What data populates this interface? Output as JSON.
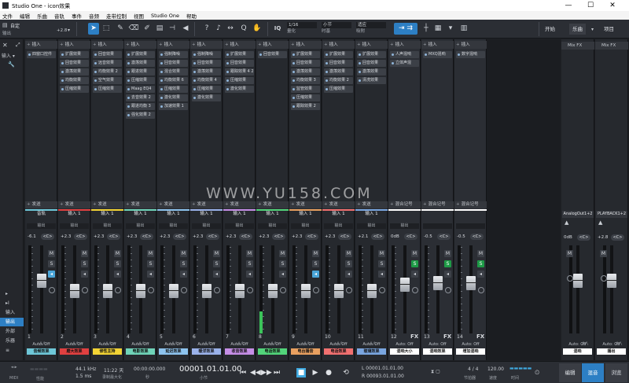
{
  "window": {
    "title": "Studio One - icon效果",
    "minimize": "—",
    "maximize": "☐",
    "close": "✕"
  },
  "menu": [
    "文件",
    "编辑",
    "乐曲",
    "音轨",
    "事件",
    "音频",
    "走带控制",
    "视图",
    "Studio One",
    "帮助"
  ],
  "toolbar": {
    "preset_name": "自定",
    "preset_sub": "输出",
    "gain_readout": "+2.8",
    "quantize": {
      "label": "1/16",
      "sub": "量化"
    },
    "timebase": {
      "label": "小节",
      "sub": "时基"
    },
    "snap": {
      "label": "适应",
      "sub": "吸附"
    },
    "iq": "IQ",
    "right_tabs": [
      "开始",
      "乐曲",
      "项目"
    ],
    "accent": "#2d7fc4"
  },
  "left_strip": {
    "close": "✕",
    "input_label": "输入 ▾",
    "tool": "🔧",
    "nav": [
      "▸",
      "▸I",
      "输入",
      "输出",
      "外部",
      "乐器",
      "≡"
    ]
  },
  "channels": [
    {
      "name": "音轨",
      "io_a": "",
      "io_b": "输出",
      "gain": "-6.1",
      "pan": "<C>",
      "number": "1",
      "auto": "Auto: Off",
      "label": "音频效果",
      "color": "#6ec7d8",
      "fader": 0.6,
      "meter": 0,
      "inserts": [
        "四窗口控件"
      ],
      "solo": false,
      "mon": true
    },
    {
      "name": "输入 1",
      "io_a": "",
      "io_b": "输出",
      "gain": "+2.3",
      "pan": "<C>",
      "number": "2",
      "auto": "Auto: Off",
      "label": "磨大效果",
      "color": "#e04040",
      "fader": 0.48,
      "meter": 0,
      "inserts": [
        "扩展效果",
        "回音效果",
        "激荡效果",
        "均衡效果",
        "压缩效果"
      ],
      "solo": false,
      "mon": false
    },
    {
      "name": "输入 1",
      "io_a": "",
      "io_b": "输出",
      "gain": "+2.3",
      "pan": "<C>",
      "number": "3",
      "auto": "Auto: Off",
      "label": "修性主持",
      "color": "#f2d335",
      "fader": 0.48,
      "meter": 0,
      "inserts": [
        "回音效果",
        "远音效果",
        "均衡效果 2",
        "空气效果",
        "压缩效果"
      ],
      "solo": false,
      "mon": false
    },
    {
      "name": "输入 1",
      "io_a": "",
      "io_b": "输出",
      "gain": "+2.3",
      "pan": "<C>",
      "number": "4",
      "auto": "Auto: Off",
      "label": "电影效果",
      "color": "#6fd3b8",
      "fader": 0.48,
      "meter": 0,
      "inserts": [
        "扩展效果",
        "激荡效果",
        "跟进效果",
        "压缩效果",
        "Maag EQ4",
        "去音效果 2",
        "跟进均衡 3",
        "强化效果 2"
      ],
      "solo": false,
      "mon": false
    },
    {
      "name": "输入 1",
      "io_a": "",
      "io_b": "输出",
      "gain": "+2.3",
      "pan": "<C>",
      "number": "5",
      "auto": "Auto: Off",
      "label": "延迟效果",
      "color": "#8dc3ee",
      "fader": 0.48,
      "meter": 0,
      "inserts": [
        "强制降噪",
        "回音效果",
        "混合效果",
        "均衡效果 6",
        "压缩效果",
        "激化效果",
        "加速效果 1"
      ],
      "solo": false,
      "mon": false
    },
    {
      "name": "输入 1",
      "io_a": "",
      "io_b": "输出",
      "gain": "+2.3",
      "pan": "<C>",
      "number": "6",
      "auto": "Auto: Off",
      "label": "暖洋效果",
      "color": "#9ab2ea",
      "fader": 0.48,
      "meter": 0,
      "inserts": [
        "强制降噪",
        "回音效果",
        "激荡效果",
        "均衡效果 4",
        "压缩效果",
        "激化效果"
      ],
      "solo": false,
      "mon": false
    },
    {
      "name": "输入 1",
      "io_a": "",
      "io_b": "输出",
      "gain": "+2.3",
      "pan": "<C>",
      "number": "7",
      "auto": "Auto: Off",
      "label": "收音效果",
      "color": "#c58ee6",
      "fader": 0.48,
      "meter": 0,
      "inserts": [
        "扩展效果",
        "回音效果",
        "跟踪效果 4 2",
        "压缩效果",
        "激化效果"
      ],
      "solo": false,
      "mon": false
    },
    {
      "name": "输入 1",
      "io_a": "",
      "io_b": "输出",
      "gain": "+2.3",
      "pan": "<C>",
      "number": "8",
      "auto": "Auto: Off",
      "label": "电话效果",
      "color": "#52d47a",
      "fader": 0.48,
      "meter": 0.25,
      "inserts": [
        "回音效果"
      ],
      "solo": false,
      "mon": false
    },
    {
      "name": "输入 1",
      "io_a": "",
      "io_b": "输出",
      "gain": "+2.3",
      "pan": "<C>",
      "number": "9",
      "auto": "Auto: Off",
      "label": "电台播音",
      "color": "#e8a060",
      "fader": 0.48,
      "meter": 0,
      "inserts": [
        "扩展效果",
        "回音效果",
        "激荡效果",
        "均衡效果 3",
        "监管效果",
        "压缩效果",
        "跟踪效果 2"
      ],
      "solo": false,
      "mon": true
    },
    {
      "name": "输入 1",
      "io_a": "",
      "io_b": "输出",
      "gain": "+2.3",
      "pan": "<C>",
      "number": "10",
      "auto": "Auto: Off",
      "label": "电话效果",
      "color": "#f07070",
      "fader": 0.48,
      "meter": 0,
      "inserts": [
        "扩展效果",
        "回音效果",
        "激荡效果",
        "均衡效果 2",
        "压缩效果"
      ],
      "solo": false,
      "mon": false
    },
    {
      "name": "输入 1",
      "io_a": "",
      "io_b": "输出",
      "gain": "+2.1",
      "pan": "<C>",
      "number": "11",
      "auto": "Auto: Off",
      "label": "玻璃效果",
      "color": "#7aa6e0",
      "fader": 0.48,
      "meter": 0,
      "inserts": [
        "扩展效果",
        "回音效果",
        "激荡效果",
        "清洗效果"
      ],
      "solo": false,
      "mon": false
    },
    {
      "name": "",
      "io_a": "",
      "io_b": "输出",
      "gain": "0dB",
      "pan": "<C>",
      "number": "12",
      "auto": "Auto: Off",
      "label": "混响大小",
      "color": "#ffffff",
      "fader": 0.55,
      "meter": 0,
      "inserts": [
        "人声混响",
        "立体声混"
      ],
      "solo": true,
      "mon": false,
      "fx": true,
      "send_head": "混合记号"
    },
    {
      "name": "",
      "io_a": "",
      "io_b": "",
      "gain": "-0.5",
      "pan": "<C>",
      "number": "13",
      "auto": "Auto: Off",
      "label": "混响效果",
      "color": "#ffffff",
      "fader": 0.57,
      "meter": 0,
      "inserts": [
        "MXQ混响"
      ],
      "solo": true,
      "mon": false,
      "fx": true,
      "send_head": "混合记号"
    },
    {
      "name": "",
      "io_a": "",
      "io_b": "",
      "gain": "-0.5",
      "pan": "<C>",
      "number": "14",
      "auto": "Auto: Off",
      "label": "增加混响",
      "color": "#ffffff",
      "fader": 0.57,
      "meter": 0,
      "inserts": [
        "数字混响"
      ],
      "solo": true,
      "mon": false,
      "fx": true,
      "send_head": "混合记号"
    }
  ],
  "right_strips": [
    {
      "head": "Mix FX",
      "name": "AnalogOut1+2",
      "gain": "0dB",
      "pan": "<C>",
      "label": "混响",
      "color": "#ffffff",
      "auto": "Auto: Off"
    },
    {
      "head": "Mix FX",
      "name": "PLAYBACK1+2",
      "gain": "+2.8",
      "pan": "<C>",
      "label": "播出",
      "color": "#ffffff",
      "auto": "Auto: Off"
    }
  ],
  "strip_common": {
    "insert_head": "插入",
    "send_head": "发送",
    "plus": "+",
    "m": "M",
    "s": "S"
  },
  "watermark": "WWW.YU158.COM",
  "transport": {
    "midi_label": "MIDI",
    "perf_label": "性能",
    "rate": "44.1 kHz",
    "latency": "1.5 ms",
    "days": "11:22 天",
    "rec_max": "录制最大化",
    "time_sec": "00:00:00.000",
    "sec_label": "秒",
    "position": "00001.01.01.00",
    "bar_label": "小节",
    "loop_l": "L  00001.01.01.00",
    "loop_r": "R  00093.01.01.00",
    "meter_sig": "4 / 4",
    "sig_label": "节拍器",
    "tempo": "120.00",
    "tempo_label": "速度",
    "time_label": "时间",
    "tabs": [
      "编辑",
      "混音",
      "浏览"
    ]
  }
}
